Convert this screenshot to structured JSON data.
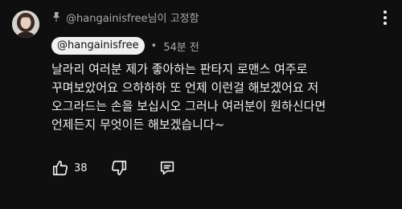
{
  "comment": {
    "pinned_label": "@hangainisfree님이 고정함",
    "author_handle": "@hangainisfree",
    "timestamp": "54분 전",
    "text_lines": [
      "날라리 여러분 제가 좋아하는 판타지 로맨스 여주로",
      "꾸며보았어요 으하하하 또 언제 이런걸 해보겠어요 저",
      "오그라드는 손을 보십시오 그러나 여러분이 원하신다면",
      "언제든지 무엇이든 해보겠습니다~"
    ],
    "like_count": "38"
  },
  "icons": {
    "pin": "pin-icon",
    "menu": "more-vertical-icon",
    "like": "thumbs-up-icon",
    "dislike": "thumbs-down-icon",
    "reply": "comment-icon"
  },
  "colors": {
    "background": "#0f0f0f",
    "text": "#f1f1f1",
    "secondary": "#aaaaaa",
    "chip": "#f1f1f1"
  }
}
